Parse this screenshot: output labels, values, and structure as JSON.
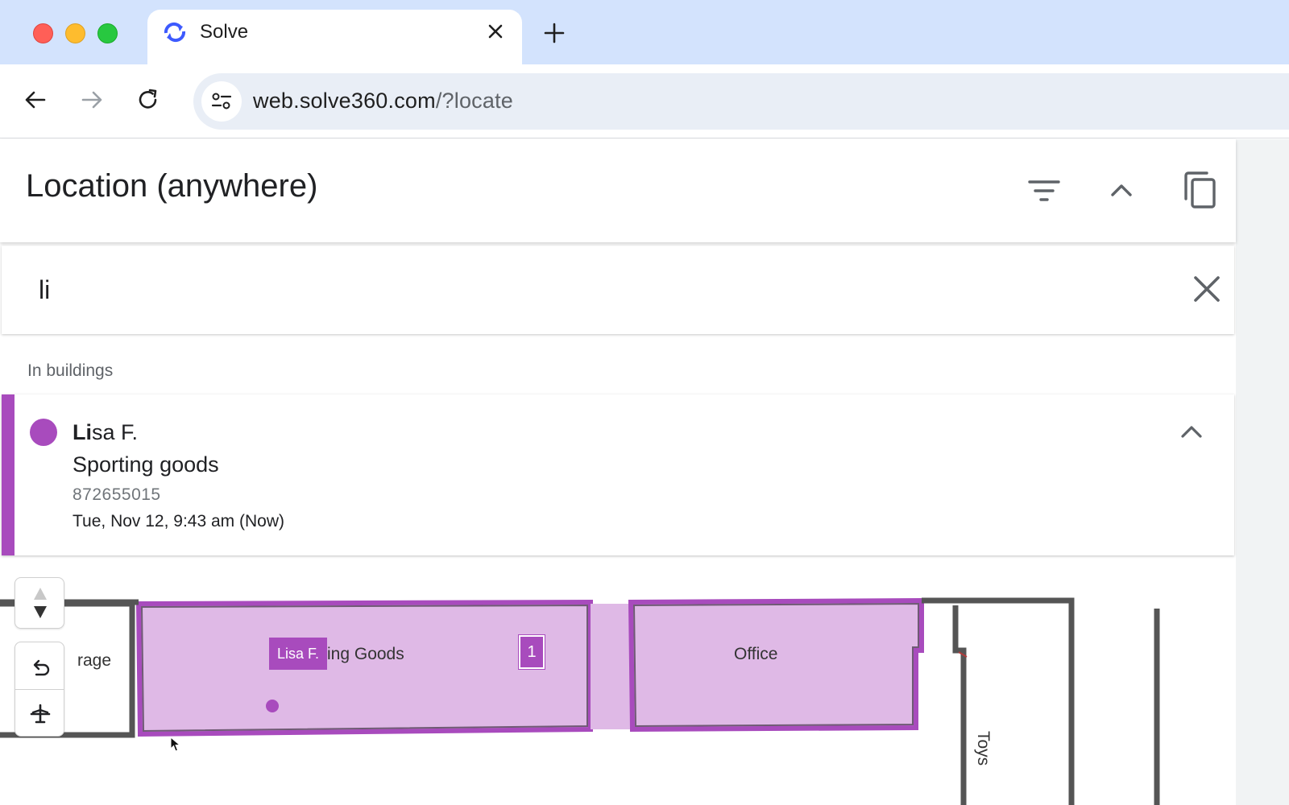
{
  "browser": {
    "tab_title": "Solve",
    "url_main": "web.solve360.com",
    "url_rest": "/?locate",
    "icons": [
      "back-arrow-icon",
      "forward-arrow-icon",
      "reload-icon",
      "site-info-icon",
      "close-icon",
      "plus-icon"
    ]
  },
  "header": {
    "title": "Location (anywhere)",
    "icons": [
      "filter-icon",
      "chevron-up-icon",
      "copy-icon"
    ]
  },
  "search": {
    "value": "li",
    "clear_icon": "close-icon"
  },
  "results": {
    "section_label": "In buildings",
    "items": [
      {
        "name_match": "Li",
        "name_rest": "sa F.",
        "place": "Sporting goods",
        "id": "872655015",
        "time": "Tue, Nov 12, 9:43 am (Now)",
        "color": "#a84bbd"
      }
    ]
  },
  "map": {
    "rooms": {
      "left_partial": "rage",
      "sporting_goods_partial": "ing Goods",
      "office": "Office",
      "toys": "Toys"
    },
    "person_badge": "Lisa F.",
    "count_badge": "1",
    "highlight_color": "#a84bbd",
    "fill_color": "#dfb9e6",
    "controls": [
      "level-arrows-icon",
      "undo-icon",
      "airplane-icon"
    ]
  }
}
